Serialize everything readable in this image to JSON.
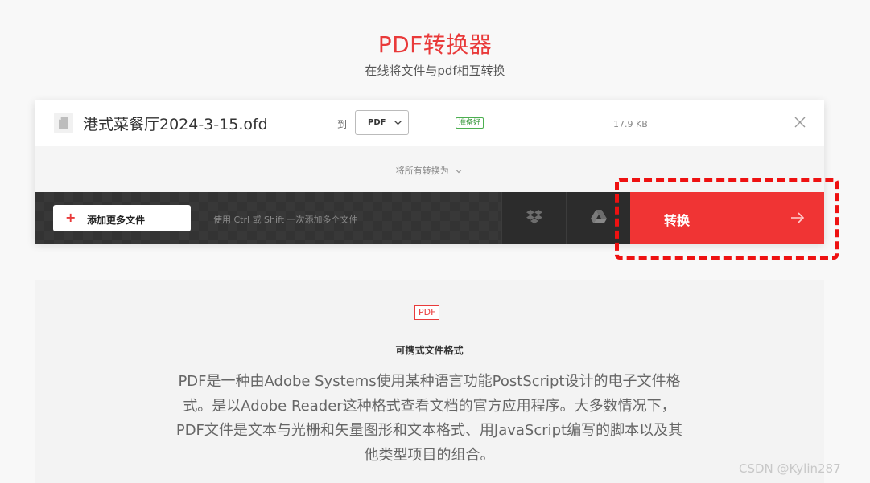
{
  "header": {
    "title": "PDF转换器",
    "subtitle": "在线将文件与pdf相互转换"
  },
  "file_row": {
    "file_icon": "document-icon",
    "file_name": "港式菜餐厅2024-3-15.ofd",
    "to_label": "到",
    "format_selected": "PDF",
    "status_badge": "准备好",
    "file_size": "17.9 KB",
    "remove_icon": "close-icon"
  },
  "convert_all": {
    "label": "将所有转换为"
  },
  "toolbar": {
    "add_button_label": "添加更多文件",
    "hint": "使用 Ctrl 或 Shift 一次添加多个文件",
    "dropbox_icon": "dropbox-icon",
    "drive_icon": "google-drive-icon",
    "convert_label": "转换",
    "convert_icon": "arrow-right-icon"
  },
  "info": {
    "badge": "PDF",
    "title": "可携式文件格式",
    "description": "PDF是一种由Adobe Systems使用某种语言功能PostScript设计的电子文件格式。是以Adobe Reader这种格式查看文档的官方应用程序。大多数情况下，PDF文件是文本与光栅和矢量图形和文本格式、用JavaScript编写的脚本以及其他类型项目的组合。"
  },
  "watermark": "CSDN @Kylin287",
  "colors": {
    "accent": "#e93a3a",
    "convert_button": "#f03434",
    "toolbar": "#333333",
    "ready": "#4caf50"
  }
}
